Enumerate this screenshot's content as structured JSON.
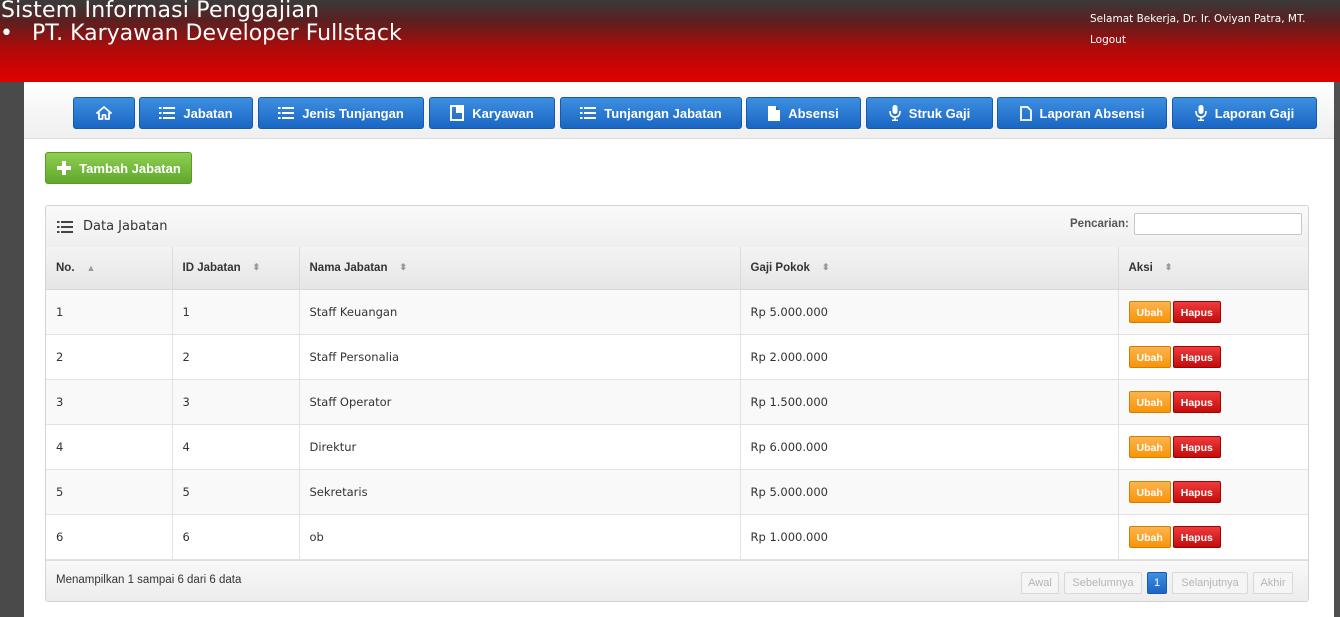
{
  "header": {
    "title": "Sistem Informasi Penggajian",
    "subtitle": "PT. Karyawan Developer Fullstack",
    "greeting": "Selamat Bekerja, Dr. Ir. Oviyan Patra, MT.",
    "logout": "Logout"
  },
  "nav": {
    "items": [
      {
        "label": "",
        "icon": "home-icon"
      },
      {
        "label": "Jabatan",
        "icon": "list-icon"
      },
      {
        "label": "Jenis Tunjangan",
        "icon": "list-icon"
      },
      {
        "label": "Karyawan",
        "icon": "book-icon"
      },
      {
        "label": "Tunjangan Jabatan",
        "icon": "list-icon"
      },
      {
        "label": "Absensi",
        "icon": "file-icon"
      },
      {
        "label": "Struk Gaji",
        "icon": "microphone-icon"
      },
      {
        "label": "Laporan Absensi",
        "icon": "file-icon"
      },
      {
        "label": "Laporan Gaji",
        "icon": "microphone-icon"
      }
    ]
  },
  "actions": {
    "add_label": "Tambah Jabatan"
  },
  "table_box": {
    "title": "Data Jabatan",
    "search_label": "Pencarian:",
    "search_value": "",
    "columns": [
      "No.",
      "ID Jabatan",
      "Nama Jabatan",
      "Gaji Pokok",
      "Aksi"
    ],
    "rows": [
      {
        "no": "1",
        "id": "1",
        "nama": "Staff Keuangan",
        "gaji": "Rp 5.000.000"
      },
      {
        "no": "2",
        "id": "2",
        "nama": "Staff Personalia",
        "gaji": "Rp 2.000.000"
      },
      {
        "no": "3",
        "id": "3",
        "nama": "Staff Operator",
        "gaji": "Rp 1.500.000"
      },
      {
        "no": "4",
        "id": "4",
        "nama": "Direktur",
        "gaji": "Rp 6.000.000"
      },
      {
        "no": "5",
        "id": "5",
        "nama": "Sekretaris",
        "gaji": "Rp 5.000.000"
      },
      {
        "no": "6",
        "id": "6",
        "nama": "ob",
        "gaji": "Rp 1.000.000"
      }
    ],
    "edit_label": "Ubah",
    "delete_label": "Hapus",
    "info": "Menampilkan 1 sampai 6 dari 6 data",
    "pagination": {
      "first": "Awal",
      "prev": "Sebelumnya",
      "current": "1",
      "next": "Selanjutnya",
      "last": "Akhir"
    }
  },
  "colors": {
    "header_red": "#e00000",
    "nav_blue": "#1a66c4",
    "add_green": "#5ea82c",
    "edit_orange": "#f89406",
    "delete_red": "#c40c0c"
  }
}
